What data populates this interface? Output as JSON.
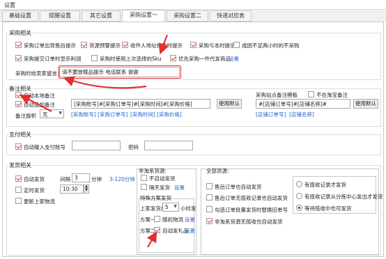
{
  "window": {
    "title": "设置"
  },
  "tabs": [
    "基础设置",
    "提醒设置",
    "其它设置",
    "采购设置一",
    "采购设置二",
    "快递对应表"
  ],
  "purchase": {
    "title": "采购相关",
    "row1": [
      "采购订单出现售后提示",
      "货源预警提示",
      "收件人地址修改时提示",
      "采购亏本时提示",
      "成团不足两小时的不采购"
    ],
    "row2": [
      "采购提交订单时显示利润",
      "采购时使用上次选择的Sku",
      "优先采购一件代发商品"
    ],
    "row2_link": "设置",
    "msg_label": "采购时给卖家留言：",
    "msg_value": "请不要放赠品提示 电话联系 谢谢"
  },
  "notes": {
    "title": "备注相关",
    "auto_local": "自动本地备注",
    "auto_append": "自动追加备注",
    "fields": "[采购账号]#[采购订单号]#[采购时间]#[采购价格]",
    "links": [
      "[采购账号]",
      "[采购订单号]",
      "[采购时间]",
      "[采购价格]"
    ],
    "flag_label": "备注旗帜",
    "flag_value": "无",
    "use_default": "使用默认",
    "site_title": "采购站点备注模板",
    "no_taobao": "不在淘宝备注",
    "site_fields": "#[店铺订单号]#[店铺名称]#",
    "site_links": [
      "[店铺订单号]",
      "[店铺名称]"
    ],
    "site_default": "使用默认"
  },
  "payment": {
    "title": "支付相关",
    "auto_input": "自动输入支付账号",
    "pwd_label": "密码"
  },
  "ship": {
    "title": "发货相关",
    "auto_ship": "自动发货",
    "interval_label": "间隔",
    "interval_value": "3",
    "minute": "分钟",
    "range": "3-120分钟",
    "timed_ship": "定时发货",
    "time_value": "10:30",
    "update_logistics": "更新上家物流"
  },
  "non_taobao": {
    "title": "非淘系货源:",
    "no_auto": "不自动发货",
    "next_day": "隔天发货",
    "next_day_link": "设置",
    "special_title": "特殊方案发货",
    "after_label": "上家发货后",
    "after_value": "5",
    "after_unit": "小时发",
    "plan1_label": "方案一",
    "plan1_opt": "随机物流",
    "plan1_link": "设置",
    "plan2_label": "方案二",
    "plan2_opt": "自动发礼品",
    "plan2_link": "设置"
  },
  "all_sources": {
    "title": "全部货源:",
    "opt1": "售后订单也自动发货",
    "opt2": "售后订单无揽收记录也自动发货",
    "opt3": "勾选订单批量发货时替换旧单号",
    "opt4": "非淘系货源无揽收也自动发货",
    "radio1": "有揽收记录才发货",
    "radio2": "有揽收记录从分拣中心发出才发货",
    "radio3": "等待揽收中也可发货"
  }
}
